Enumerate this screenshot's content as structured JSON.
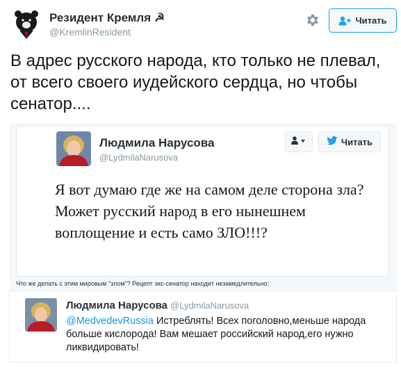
{
  "tweet": {
    "author_name": "Резидент Кремля ☭",
    "author_handle": "@KremlinResident",
    "follow_label": "Читать",
    "text": "В адрес русского народа, кто только не плевал, от всего своего иудейского сердца, но чтобы сенатор...."
  },
  "embedded_tweet": {
    "author_name": "Людмила Нарусова",
    "author_handle": "@LydmilaNarusova",
    "follow_label": "Читать",
    "text": "Я вот думаю где же на самом деле сторона зла? Может русский народ в его нынешнем воплощение и есть само ЗЛО!!!?"
  },
  "caption": "Что же делать с этим мировым \"злом\"? Рецепт экс-сенатор находит незамедлительно:",
  "reply_tweet": {
    "author_name": "Людмила Нарусова",
    "author_handle": "@LydmilaNarusova",
    "mention": "@MedvedevRussia",
    "text": " Истреблять! Всех поголовно,меньше народа больше кислорода! Вам мешает российский народ,его нужно ликвидировать!"
  },
  "colors": {
    "accent": "#1da1f2",
    "link": "#1b95e0",
    "muted": "#8899a6",
    "embed_bg": "#f5f8fa"
  },
  "icons": {
    "gear": "gear-icon",
    "follow": "add-user-icon",
    "twitter": "twitter-bird-icon",
    "user_dropdown": "user-dropdown-icon"
  }
}
